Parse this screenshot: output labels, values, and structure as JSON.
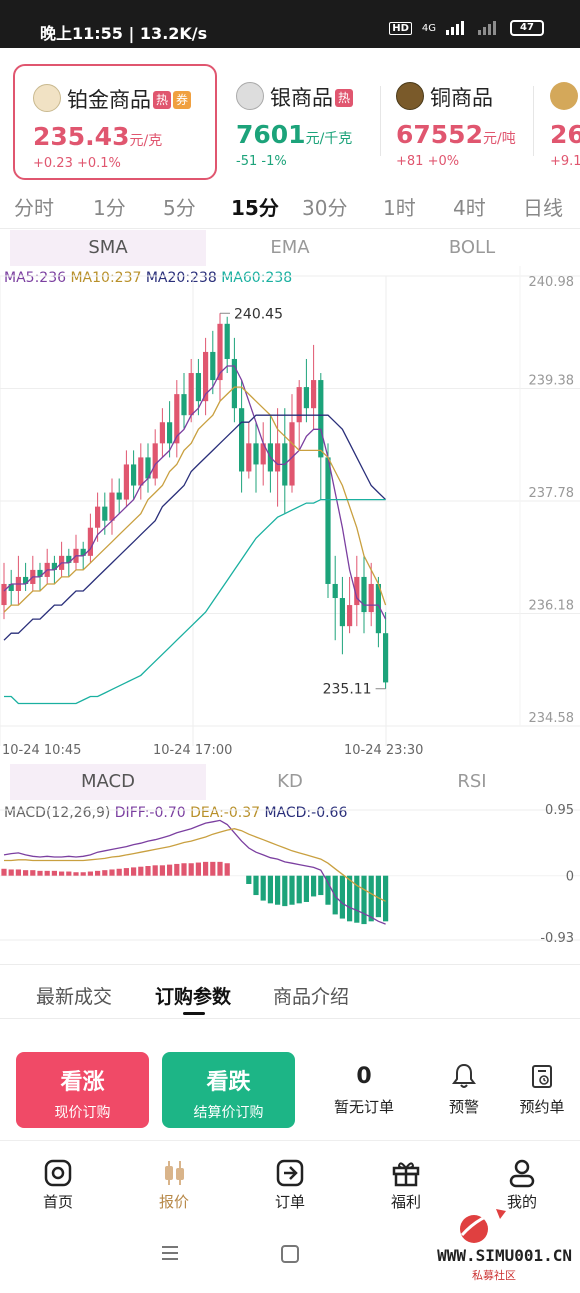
{
  "status_bar": {
    "time": "晚上11:55",
    "speed": "13.2K/s",
    "hd": "HD",
    "network": "4G",
    "battery": "47"
  },
  "products": [
    {
      "name": "铂金商品",
      "tags": [
        "热",
        "券"
      ],
      "price": "235.43",
      "unit": "元/克",
      "change": "+0.23",
      "pct": "+0.1%",
      "trend": "up"
    },
    {
      "name": "银商品",
      "tags": [
        "热"
      ],
      "price": "7601",
      "unit": "元/千克",
      "change": "-51",
      "pct": "-1%",
      "trend": "down"
    },
    {
      "name": "铜商品",
      "tags": [],
      "price": "67552",
      "unit": "元/吨",
      "change": "+81",
      "pct": "+0%",
      "trend": "up"
    },
    {
      "name": "",
      "tags": [],
      "price": "26",
      "unit": "",
      "change": "+9.1",
      "pct": "",
      "trend": "up"
    }
  ],
  "timeframes": [
    "分时",
    "1分",
    "5分",
    "15分",
    "30分",
    "1时",
    "4时",
    "日线"
  ],
  "timeframe_selected": "15分",
  "main_indicator_tabs": [
    "SMA",
    "EMA",
    "BOLL"
  ],
  "main_indicator_selected": "SMA",
  "ma_legend": {
    "ma5": "MA5:236",
    "ma10": "MA10:237",
    "ma20": "MA20:238",
    "ma60": "MA60:238"
  },
  "sub_indicator_tabs": [
    "MACD",
    "KD",
    "RSI"
  ],
  "sub_indicator_selected": "MACD",
  "macd_legend": {
    "name": "MACD(12,26,9)",
    "diff": "DIFF:-0.70",
    "dea": "DEA:-0.37",
    "macd": "MACD:-0.66"
  },
  "info_tabs": [
    "最新成交",
    "订购参数",
    "商品介绍"
  ],
  "info_tab_selected": "订购参数",
  "actions": {
    "buy_up": {
      "title": "看涨",
      "sub": "现价订购"
    },
    "buy_down": {
      "title": "看跌",
      "sub": "结算价订购"
    },
    "orders_count": "0",
    "orders_label": "暂无订单",
    "alert_label": "预警",
    "reserve_label": "预约单"
  },
  "tabbar": [
    "首页",
    "报价",
    "订单",
    "福利",
    "我的"
  ],
  "tabbar_selected": "报价",
  "watermark": {
    "url": "WWW.SIMU001.CN",
    "cn": "私募社区"
  },
  "colors": {
    "up": "#e0566f",
    "down": "#1ca37a",
    "ma5": "#7b3fa0",
    "ma10": "#c9a040",
    "ma20": "#2a2f7a",
    "ma60": "#1ab0a0",
    "macd_dea": "#c9a040",
    "macd_diff": "#7b3fa0"
  },
  "chart_data": [
    {
      "type": "candlestick",
      "title": "",
      "ylim": [
        234.58,
        240.98
      ],
      "y_ticks": [
        "240.98",
        "239.38",
        "237.78",
        "236.18",
        "234.58"
      ],
      "x_ticks": [
        "10-24 10:45",
        "10-24 17:00",
        "10-24 23:30"
      ],
      "annotations": {
        "high": "240.45",
        "low": "235.11"
      },
      "candles": [
        [
          236.3,
          236.6,
          236.9,
          236.1
        ],
        [
          236.6,
          236.5,
          236.8,
          236.3
        ],
        [
          236.5,
          236.7,
          237.0,
          236.3
        ],
        [
          236.7,
          236.6,
          236.9,
          236.5
        ],
        [
          236.6,
          236.8,
          237.0,
          236.5
        ],
        [
          236.8,
          236.7,
          236.9,
          236.5
        ],
        [
          236.7,
          236.9,
          237.1,
          236.6
        ],
        [
          236.9,
          236.8,
          237.0,
          236.6
        ],
        [
          236.8,
          237.0,
          237.2,
          236.7
        ],
        [
          237.0,
          236.9,
          237.1,
          236.7
        ],
        [
          236.9,
          237.1,
          237.3,
          236.8
        ],
        [
          237.1,
          237.0,
          237.2,
          236.8
        ],
        [
          237.0,
          237.4,
          237.6,
          236.9
        ],
        [
          237.4,
          237.7,
          237.9,
          237.2
        ],
        [
          237.7,
          237.5,
          237.9,
          237.3
        ],
        [
          237.5,
          237.9,
          238.1,
          237.3
        ],
        [
          237.9,
          237.8,
          238.1,
          237.6
        ],
        [
          237.8,
          238.3,
          238.5,
          237.7
        ],
        [
          238.3,
          238.0,
          238.5,
          237.8
        ],
        [
          238.0,
          238.4,
          238.6,
          237.8
        ],
        [
          238.4,
          238.1,
          238.6,
          237.9
        ],
        [
          238.1,
          238.6,
          238.8,
          238.0
        ],
        [
          238.6,
          238.9,
          239.1,
          238.4
        ],
        [
          238.9,
          238.6,
          239.2,
          238.4
        ],
        [
          238.6,
          239.3,
          239.5,
          238.4
        ],
        [
          239.3,
          239.0,
          239.6,
          238.8
        ],
        [
          239.0,
          239.6,
          239.8,
          238.9
        ],
        [
          239.6,
          239.2,
          239.8,
          239.0
        ],
        [
          239.2,
          239.9,
          240.1,
          239.0
        ],
        [
          239.9,
          239.5,
          240.2,
          239.3
        ],
        [
          239.5,
          240.3,
          240.45,
          239.2
        ],
        [
          240.3,
          239.8,
          240.4,
          239.6
        ],
        [
          239.8,
          239.1,
          240.1,
          238.9
        ],
        [
          239.1,
          238.2,
          239.5,
          237.9
        ],
        [
          238.2,
          238.6,
          238.9,
          238.1
        ],
        [
          238.6,
          238.3,
          238.9,
          237.9
        ],
        [
          238.3,
          238.6,
          238.9,
          238.0
        ],
        [
          238.6,
          238.2,
          239.0,
          237.9
        ],
        [
          238.2,
          238.6,
          239.1,
          237.7
        ],
        [
          238.6,
          238.0,
          239.1,
          237.6
        ],
        [
          238.0,
          238.9,
          239.3,
          237.9
        ],
        [
          238.9,
          239.4,
          239.5,
          238.5
        ],
        [
          239.4,
          239.1,
          239.8,
          238.9
        ],
        [
          239.1,
          239.5,
          240.0,
          238.8
        ],
        [
          239.5,
          238.4,
          239.6,
          237.8
        ],
        [
          238.4,
          236.6,
          238.6,
          236.4
        ],
        [
          236.6,
          236.4,
          237.0,
          235.8
        ],
        [
          236.4,
          236.0,
          236.7,
          235.6
        ],
        [
          236.0,
          236.3,
          236.7,
          235.9
        ],
        [
          236.3,
          236.7,
          237.0,
          236.0
        ],
        [
          236.7,
          236.2,
          237.0,
          235.9
        ],
        [
          236.2,
          236.6,
          236.9,
          236.0
        ],
        [
          236.6,
          235.9,
          236.7,
          235.7
        ],
        [
          235.9,
          235.2,
          236.2,
          235.11
        ]
      ],
      "series": [
        {
          "name": "MA5",
          "values": [
            236.5,
            236.6,
            236.6,
            236.6,
            236.7,
            236.7,
            236.8,
            236.8,
            236.9,
            236.9,
            237.0,
            237.0,
            237.1,
            237.3,
            237.4,
            237.5,
            237.6,
            237.7,
            237.8,
            238.0,
            238.1,
            238.3,
            238.4,
            238.5,
            238.7,
            238.8,
            239.0,
            239.1,
            239.3,
            239.4,
            239.6,
            239.7,
            239.7,
            239.5,
            239.2,
            238.9,
            238.6,
            238.4,
            238.3,
            238.3,
            238.4,
            238.5,
            238.7,
            238.8,
            238.8,
            238.4,
            237.9,
            237.4,
            236.8,
            236.4,
            236.3,
            236.3,
            236.3,
            236.1
          ]
        },
        {
          "name": "MA10",
          "values": [
            236.2,
            236.3,
            236.3,
            236.4,
            236.5,
            236.5,
            236.6,
            236.6,
            236.7,
            236.7,
            236.8,
            236.8,
            236.9,
            237.0,
            237.1,
            237.2,
            237.3,
            237.4,
            237.5,
            237.6,
            237.8,
            237.9,
            238.0,
            238.2,
            238.3,
            238.5,
            238.6,
            238.8,
            238.9,
            239.0,
            239.2,
            239.3,
            239.4,
            239.4,
            239.3,
            239.2,
            239.1,
            239.0,
            238.8,
            238.7,
            238.6,
            238.5,
            238.5,
            238.5,
            238.5,
            238.4,
            238.2,
            238.0,
            237.7,
            237.4,
            237.0,
            236.8,
            236.6,
            236.3
          ]
        },
        {
          "name": "MA20",
          "values": [
            235.8,
            235.9,
            235.9,
            236.0,
            236.1,
            236.1,
            236.2,
            236.3,
            236.3,
            236.4,
            236.5,
            236.5,
            236.6,
            236.7,
            236.8,
            236.9,
            237.0,
            237.1,
            237.2,
            237.3,
            237.4,
            237.5,
            237.7,
            237.8,
            237.9,
            238.0,
            238.2,
            238.3,
            238.4,
            238.5,
            238.6,
            238.7,
            238.8,
            238.9,
            238.9,
            239.0,
            239.0,
            239.0,
            239.0,
            239.0,
            239.0,
            239.0,
            239.0,
            239.0,
            239.0,
            239.0,
            238.9,
            238.8,
            238.6,
            238.4,
            238.2,
            238.0,
            237.9,
            237.8
          ]
        },
        {
          "name": "MA60",
          "values": [
            235.0,
            235.0,
            234.9,
            234.9,
            234.9,
            234.9,
            234.9,
            234.9,
            234.9,
            234.9,
            234.9,
            234.95,
            235.0,
            235.0,
            235.05,
            235.1,
            235.15,
            235.2,
            235.25,
            235.3,
            235.4,
            235.5,
            235.6,
            235.7,
            235.8,
            235.9,
            236.0,
            236.1,
            236.2,
            236.35,
            236.5,
            236.65,
            236.8,
            236.95,
            237.1,
            237.25,
            237.35,
            237.45,
            237.55,
            237.6,
            237.65,
            237.7,
            237.75,
            237.75,
            237.8,
            237.8,
            237.8,
            237.8,
            237.8,
            237.8,
            237.8,
            237.8,
            237.8,
            237.8
          ]
        }
      ]
    },
    {
      "type": "bar",
      "title": "",
      "ylim": [
        -0.93,
        0.95
      ],
      "y_ticks": [
        "0.95",
        "0",
        "-0.93"
      ],
      "series": [
        {
          "name": "MACD",
          "values": [
            0.1,
            0.09,
            0.09,
            0.08,
            0.08,
            0.07,
            0.07,
            0.07,
            0.06,
            0.06,
            0.05,
            0.05,
            0.06,
            0.07,
            0.08,
            0.09,
            0.1,
            0.11,
            0.12,
            0.13,
            0.14,
            0.15,
            0.15,
            0.16,
            0.17,
            0.18,
            0.18,
            0.19,
            0.2,
            0.2,
            0.2,
            0.18,
            0,
            0,
            -0.12,
            -0.28,
            -0.36,
            -0.4,
            -0.42,
            -0.44,
            -0.42,
            -0.4,
            -0.38,
            -0.3,
            -0.28,
            -0.42,
            -0.56,
            -0.62,
            -0.66,
            -0.68,
            -0.7,
            -0.66,
            -0.6,
            -0.66
          ]
        },
        {
          "name": "DIFF",
          "values": [
            0.3,
            0.32,
            0.33,
            0.3,
            0.28,
            0.27,
            0.28,
            0.27,
            0.27,
            0.28,
            0.27,
            0.28,
            0.3,
            0.34,
            0.36,
            0.38,
            0.4,
            0.42,
            0.45,
            0.47,
            0.5,
            0.52,
            0.55,
            0.58,
            0.62,
            0.65,
            0.68,
            0.72,
            0.76,
            0.78,
            0.8,
            0.74,
            0.62,
            0.5,
            0.4,
            0.34,
            0.3,
            0.26,
            0.24,
            0.2,
            0.18,
            0.16,
            0.14,
            0.12,
            0.08,
            -0.1,
            -0.3,
            -0.4,
            -0.46,
            -0.5,
            -0.55,
            -0.6,
            -0.66,
            -0.7
          ]
        },
        {
          "name": "DEA",
          "values": [
            0.22,
            0.22,
            0.23,
            0.23,
            0.22,
            0.22,
            0.22,
            0.22,
            0.22,
            0.22,
            0.22,
            0.22,
            0.23,
            0.24,
            0.25,
            0.27,
            0.28,
            0.3,
            0.32,
            0.34,
            0.36,
            0.38,
            0.4,
            0.42,
            0.45,
            0.48,
            0.5,
            0.53,
            0.56,
            0.6,
            0.63,
            0.66,
            0.68,
            0.65,
            0.6,
            0.56,
            0.52,
            0.48,
            0.44,
            0.4,
            0.36,
            0.33,
            0.3,
            0.27,
            0.24,
            0.18,
            0.1,
            0.02,
            -0.06,
            -0.14,
            -0.2,
            -0.26,
            -0.32,
            -0.37
          ]
        }
      ]
    }
  ]
}
